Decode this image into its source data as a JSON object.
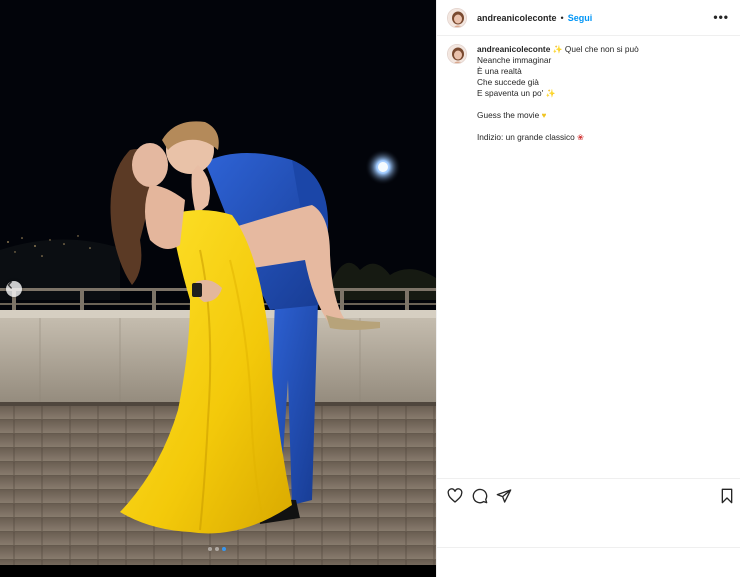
{
  "post": {
    "username": "andreanicoleconte",
    "separator": "•",
    "follow_label": "Segui",
    "more_icon": "•••"
  },
  "caption": {
    "username": "andreanicoleconte",
    "line1": "Quel che non si può",
    "line2": "Neanche immaginar",
    "line3": "È una realtà",
    "line4": "Che succede già",
    "line5": "E spaventa un po'",
    "line6": "Guess the movie",
    "line7": "Indizio: un grande classico",
    "emoji_sparkle": "sparkles-emoji",
    "emoji_heart": "yellow-heart-emoji",
    "emoji_rose": "rose-emoji"
  },
  "carousel": {
    "slides": 3,
    "active_index": 2
  },
  "icons": {
    "prev": "chevron-left-icon",
    "like": "heart-icon",
    "comment": "comment-icon",
    "share": "send-icon",
    "save": "bookmark-icon",
    "more": "more-horizontal-icon"
  },
  "colors": {
    "follow": "#0095f6",
    "text": "#262626",
    "divider": "#efefef",
    "dress": "#f6d20c",
    "suit": "#1f4fb8"
  }
}
